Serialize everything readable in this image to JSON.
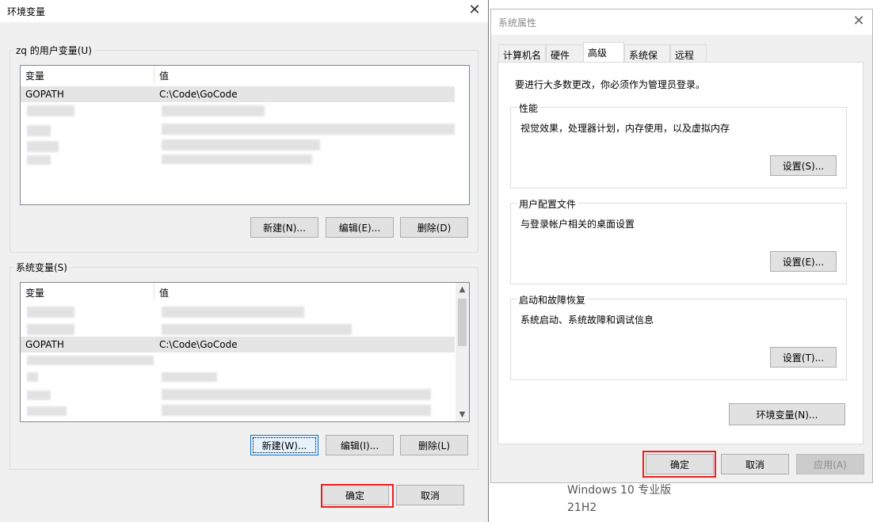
{
  "env": {
    "title": "环境变量",
    "user_group_label": "zq 的用户变量(U)",
    "user_vars": {
      "col_var": "变量",
      "col_val": "值",
      "rows": [
        {
          "name": "GOPATH",
          "value": "C:\\Code\\GoCode"
        }
      ]
    },
    "user_buttons": {
      "new": "新建(N)...",
      "edit": "编辑(E)...",
      "delete": "删除(D)"
    },
    "sys_group_label": "系统变量(S)",
    "sys_vars": {
      "col_var": "变量",
      "col_val": "值",
      "rows": [
        {
          "name": "GOPATH",
          "value": "C:\\Code\\GoCode"
        }
      ]
    },
    "sys_buttons": {
      "new": "新建(W)...",
      "edit": "编辑(I)...",
      "delete": "删除(L)"
    },
    "ok": "确定",
    "cancel": "取消"
  },
  "sysprops": {
    "title": "系统属性",
    "tabs": [
      "计算机名",
      "硬件",
      "高级",
      "系统保护",
      "远程"
    ],
    "active_tab": "高级",
    "admin_note": "要进行大多数更改，你必须作为管理员登录。",
    "performance": {
      "title": "性能",
      "desc": "视觉效果，处理器计划，内存使用，以及虚拟内存",
      "button": "设置(S)..."
    },
    "profiles": {
      "title": "用户配置文件",
      "desc": "与登录帐户相关的桌面设置",
      "button": "设置(E)..."
    },
    "startup": {
      "title": "启动和故障恢复",
      "desc": "系统启动、系统故障和调试信息",
      "button": "设置(T)..."
    },
    "env_button": "环境变量(N)...",
    "ok": "确定",
    "cancel": "取消",
    "apply": "应用(A)"
  },
  "background": {
    "os_name": "Windows 10 专业版",
    "os_version": "21H2"
  },
  "colors": {
    "highlight_box": "#e8201c",
    "focus_border": "#0078d7"
  }
}
